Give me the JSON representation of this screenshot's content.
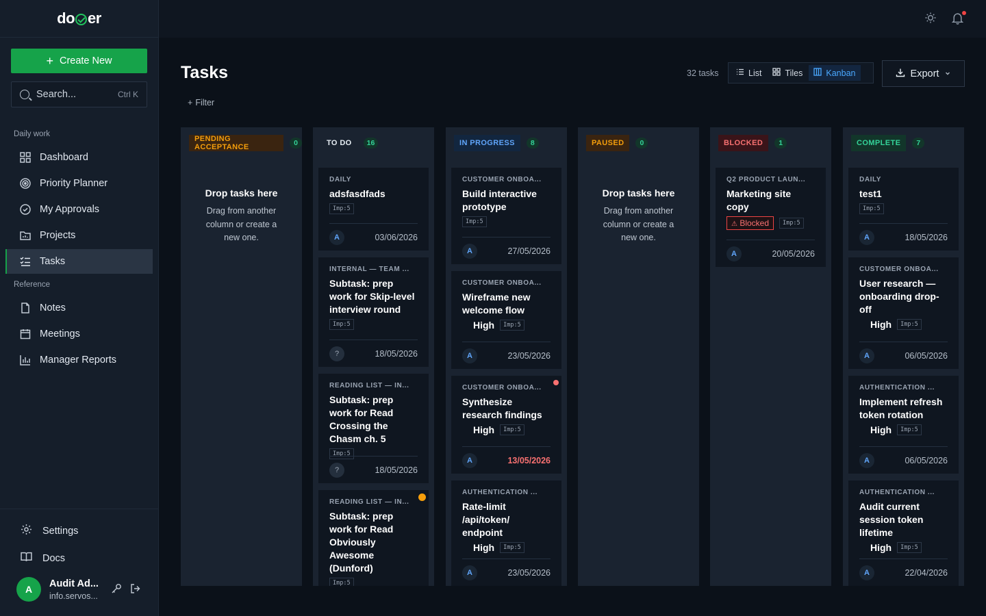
{
  "app": {
    "logo_left": "do",
    "logo_right": "er"
  },
  "sidebar": {
    "create_label": "Create New",
    "search_placeholder": "Search...",
    "search_shortcut": "Ctrl K",
    "section_daily": "Daily work",
    "section_reference": "Reference",
    "items": [
      {
        "label": "Dashboard",
        "icon": "dashboard-icon"
      },
      {
        "label": "Priority Planner",
        "icon": "target-icon"
      },
      {
        "label": "My Approvals",
        "icon": "check-circle-icon"
      },
      {
        "label": "Projects",
        "icon": "folder-icon"
      },
      {
        "label": "Tasks",
        "icon": "list-check-icon"
      },
      {
        "label": "Notes",
        "icon": "file-icon"
      },
      {
        "label": "Meetings",
        "icon": "calendar-icon"
      },
      {
        "label": "Manager Reports",
        "icon": "bar-chart-icon"
      }
    ],
    "settings_label": "Settings",
    "docs_label": "Docs",
    "user": {
      "initial": "A",
      "name": "Audit Ad...",
      "email": "info.servos..."
    }
  },
  "header": {
    "title": "Tasks",
    "filter_label": "Filter",
    "task_count": "32 tasks",
    "views": [
      "List",
      "Tiles",
      "Kanban"
    ],
    "active_view": "Kanban",
    "export_label": "Export"
  },
  "drop_zone": {
    "title": "Drop tasks here",
    "subtitle": "Drag from another column or create a new one."
  },
  "columns": [
    {
      "status": "PENDING ACCEPTANCE",
      "count": "0",
      "tag_bg": "#3a2410",
      "tag_fg": "#f59e0b"
    },
    {
      "status": "TO DO",
      "count": "16",
      "tag_bg": "#1a2330",
      "tag_fg": "#e6edf3"
    },
    {
      "status": "IN PROGRESS",
      "count": "8",
      "tag_bg": "#12263f",
      "tag_fg": "#60a5fa"
    },
    {
      "status": "PAUSED",
      "count": "0",
      "tag_bg": "#3a2410",
      "tag_fg": "#f59e0b"
    },
    {
      "status": "BLOCKED",
      "count": "1",
      "tag_bg": "#3a1419",
      "tag_fg": "#f87171"
    },
    {
      "status": "COMPLETE",
      "count": "7",
      "tag_bg": "#12362a",
      "tag_fg": "#34d399"
    }
  ],
  "cards": {
    "todo": [
      {
        "cat": "DAILY",
        "title": "adsfasdfads",
        "imp": "Imp:5",
        "avatar": "A",
        "date": "03/06/2026"
      },
      {
        "cat": "INTERNAL — TEAM ...",
        "title": "Subtask: prep work for Skip-level interview round",
        "imp": "Imp:5",
        "avatar": "?",
        "date": "18/05/2026"
      },
      {
        "cat": "READING LIST — IN...",
        "title": "Subtask: prep work for Read Crossing the Chasm ch. 5",
        "imp": "Imp:5",
        "avatar": "?",
        "date": "18/05/2026"
      },
      {
        "cat": "READING LIST — IN...",
        "title": "Subtask: prep work for Read Obviously Awesome (Dunford)",
        "imp": "Imp:5"
      }
    ],
    "inprogress": [
      {
        "cat": "CUSTOMER ONBOA...",
        "title": "Build interactive prototype",
        "imp": "Imp:5",
        "avatar": "A",
        "date": "27/05/2026"
      },
      {
        "cat": "CUSTOMER ONBOA...",
        "title": "Wireframe new welcome flow",
        "priority": "High",
        "imp": "Imp:5",
        "avatar": "A",
        "date": "23/05/2026"
      },
      {
        "cat": "CUSTOMER ONBOA...",
        "title": "Synthesize research findings",
        "priority": "High",
        "imp": "Imp:5",
        "avatar": "A",
        "date": "13/05/2026"
      },
      {
        "cat": "AUTHENTICATION ...",
        "title": "Rate-limit /api/token/ endpoint",
        "priority": "High",
        "imp": "Imp:5",
        "avatar": "A",
        "date": "23/05/2026"
      }
    ],
    "blocked": [
      {
        "cat": "Q2 PRODUCT LAUN...",
        "title": "Marketing site copy",
        "blocked_label": "Blocked",
        "imp": "Imp:5",
        "avatar": "A",
        "date": "20/05/2026"
      }
    ],
    "complete": [
      {
        "cat": "DAILY",
        "title": "test1",
        "imp": "Imp:5",
        "avatar": "A",
        "date": "18/05/2026"
      },
      {
        "cat": "CUSTOMER ONBOA...",
        "title": "User research — onboarding drop-off",
        "priority": "High",
        "imp": "Imp:5",
        "avatar": "A",
        "date": "06/05/2026"
      },
      {
        "cat": "AUTHENTICATION ...",
        "title": "Implement refresh token rotation",
        "priority": "High",
        "imp": "Imp:5",
        "avatar": "A",
        "date": "06/05/2026"
      },
      {
        "cat": "AUTHENTICATION ...",
        "title": "Audit current session token lifetime",
        "priority": "High",
        "imp": "Imp:5",
        "avatar": "A",
        "date": "22/04/2026"
      }
    ]
  }
}
